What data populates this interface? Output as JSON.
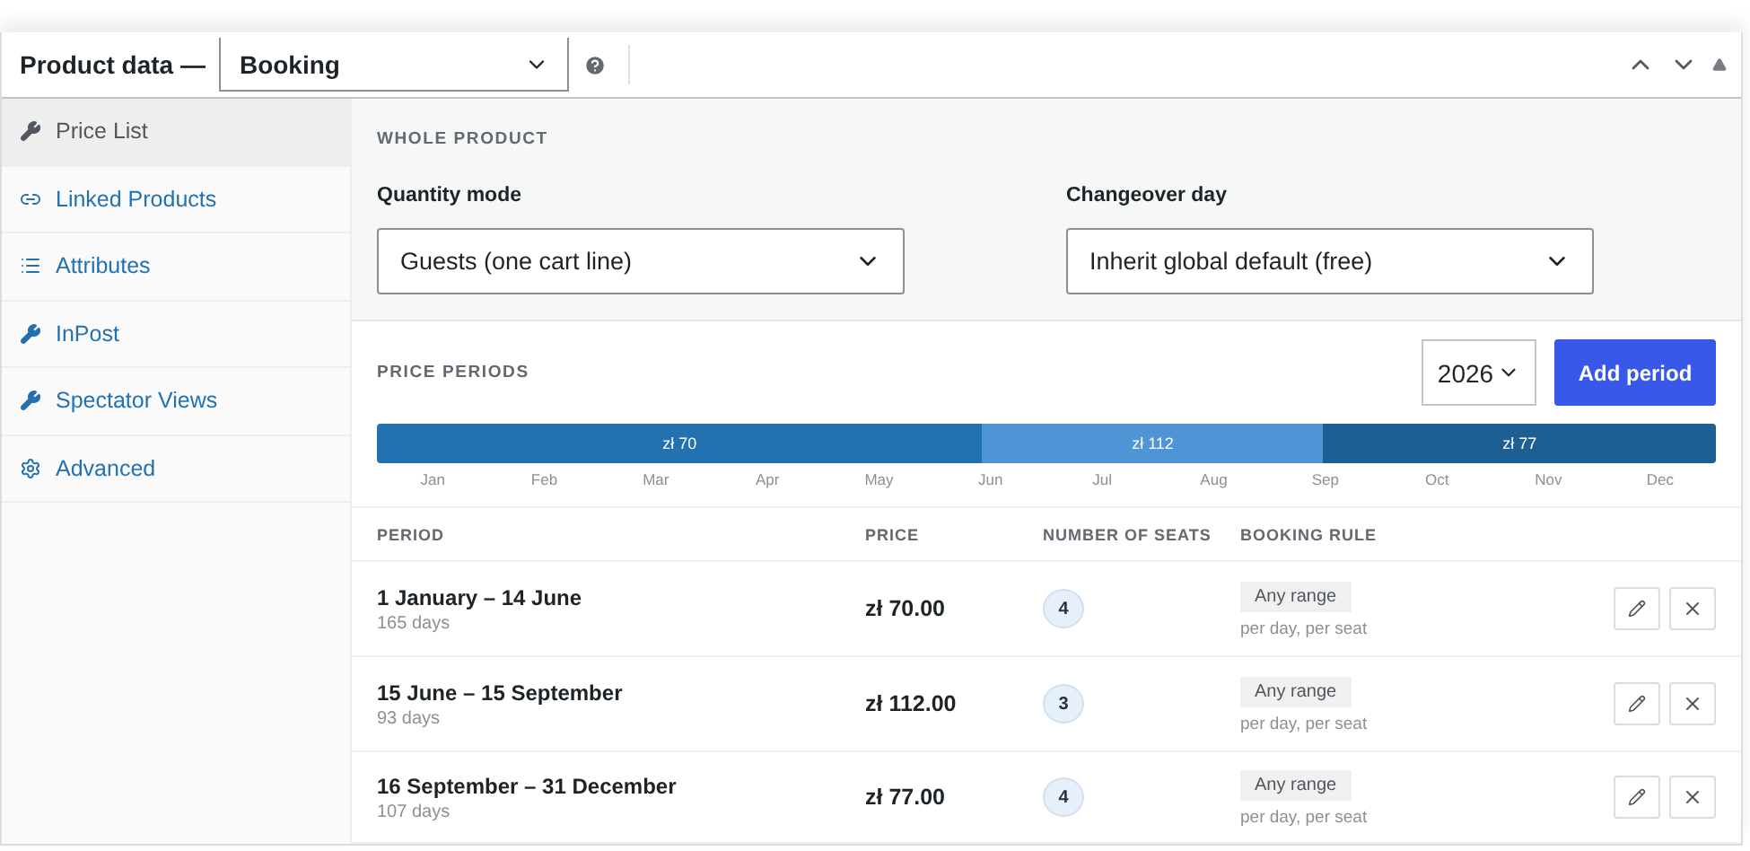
{
  "header": {
    "title": "Product data —",
    "product_type": "Booking"
  },
  "sidebar": {
    "items": [
      {
        "label": "Price List",
        "kind": "tool",
        "selected": true
      },
      {
        "label": "Linked Products",
        "kind": "link",
        "selected": false
      },
      {
        "label": "Attributes",
        "kind": "list",
        "selected": false
      },
      {
        "label": "InPost",
        "kind": "tool",
        "selected": false
      },
      {
        "label": "Spectator Views",
        "kind": "tool",
        "selected": false
      },
      {
        "label": "Advanced",
        "kind": "gear",
        "selected": false
      }
    ]
  },
  "whole_product": {
    "heading": "WHOLE PRODUCT",
    "fields": [
      {
        "label": "Quantity mode",
        "value": "Guests (one cart line)"
      },
      {
        "label": "Changeover day",
        "value": "Inherit global default (free)"
      }
    ]
  },
  "price_periods": {
    "heading": "PRICE PERIODS",
    "year": "2026",
    "add_button": "Add period",
    "timeline": [
      {
        "label": "zł 70",
        "color": "#2271b1"
      },
      {
        "label": "zł 112",
        "color": "#4f94d4"
      },
      {
        "label": "zł 77",
        "color": "#1d5e93"
      }
    ],
    "months": [
      "Jan",
      "Feb",
      "Mar",
      "Apr",
      "May",
      "Jun",
      "Jul",
      "Aug",
      "Sep",
      "Oct",
      "Nov",
      "Dec"
    ],
    "columns": [
      "PERIOD",
      "PRICE",
      "NUMBER OF SEATS",
      "BOOKING RULE"
    ],
    "rows": [
      {
        "period": "1 January – 14 June",
        "days": "165 days",
        "price": "zł 70.00",
        "seats": "4",
        "rule": "Any range",
        "rule_note": "per day, per seat"
      },
      {
        "period": "15 June – 15 September",
        "days": "93 days",
        "price": "zł 112.00",
        "seats": "3",
        "rule": "Any range",
        "rule_note": "per day, per seat"
      },
      {
        "period": "16 September – 31 December",
        "days": "107 days",
        "price": "zł 77.00",
        "seats": "4",
        "rule": "Any range",
        "rule_note": "per day, per seat"
      }
    ]
  }
}
